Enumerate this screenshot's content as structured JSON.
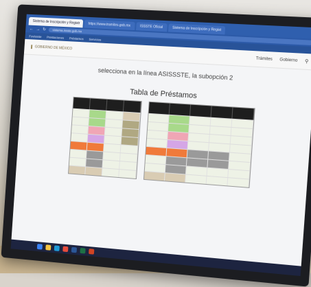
{
  "browser": {
    "tabs": [
      {
        "label": "Sistema de Inscripción y Registr"
      },
      {
        "label": "https://www.tramites.gob.mx"
      },
      {
        "label": "ISSSTE Oficial"
      },
      {
        "label": "Sistema de Inscripción y Regist"
      }
    ],
    "url": "sistema.issste.gob.mx",
    "bookmarks": [
      "Fovissste",
      "Prestaciones",
      "Préstamos",
      "Servicios"
    ]
  },
  "site": {
    "logo_text": "GOBIERNO DE MÉXICO",
    "nav": [
      "Trámites",
      "Gobierno"
    ],
    "search_icon": "search-icon"
  },
  "page": {
    "subtitle": "selecciona en la línea ASISSSTE, la subopción 2",
    "table_title": "Tabla de Préstamos"
  },
  "colors": {
    "browser_blue": "#2f5fae",
    "green": "#a8d98a",
    "pink": "#f0a6b5",
    "orange": "#f07a3a",
    "gray": "#9a9a9a"
  }
}
